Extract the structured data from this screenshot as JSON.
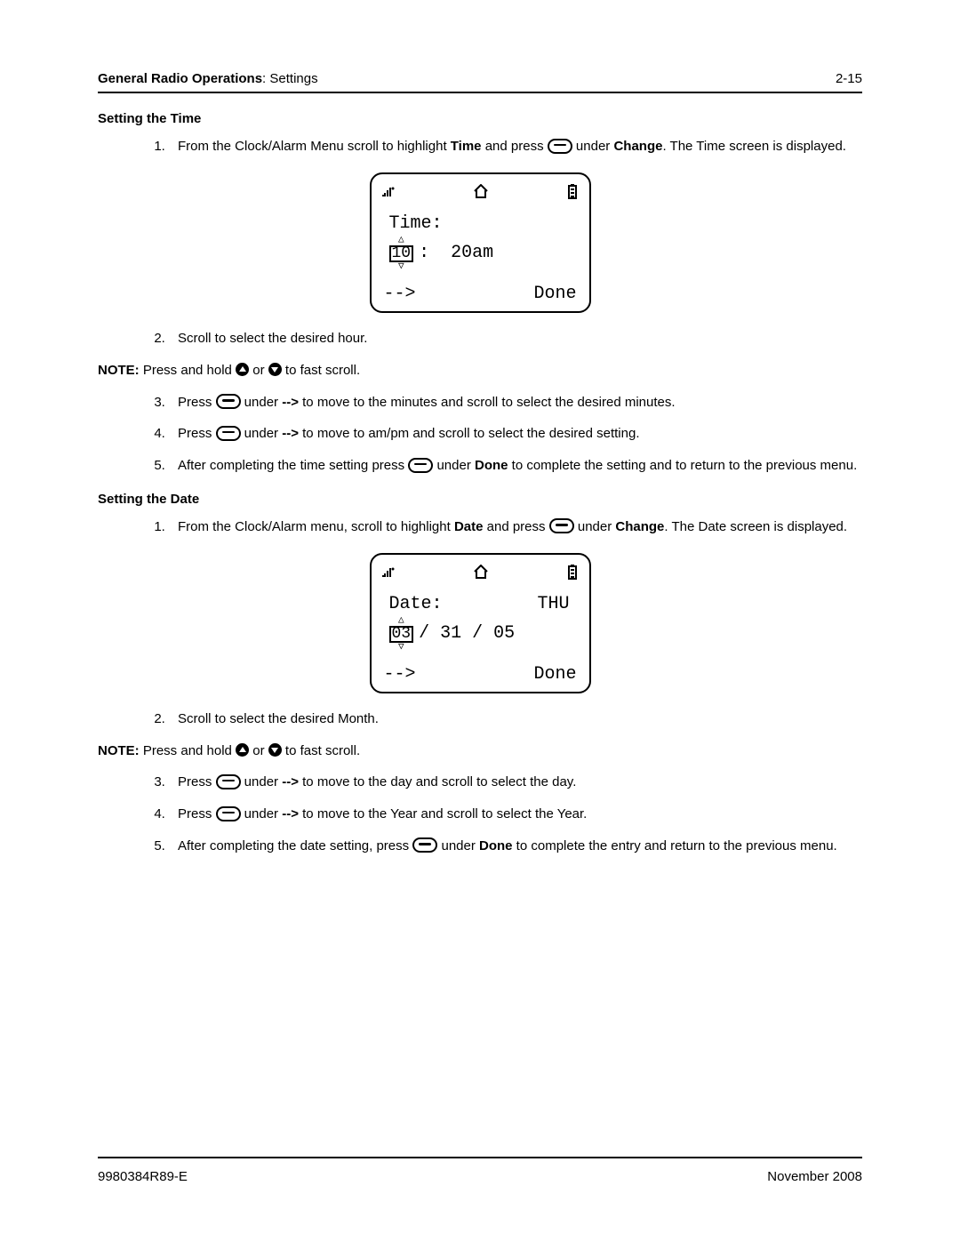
{
  "header": {
    "left_bold": "General Radio Operations",
    "left_rest": ": Settings",
    "right": "2-15"
  },
  "sections": {
    "time": {
      "heading": "Setting the Time",
      "step1a": "From the Clock/Alarm Menu scroll to highlight ",
      "step1b": "Time",
      "step1c": " and press ",
      "step1d": " under ",
      "step1e": "Change",
      "step1f": ". The Time screen is displayed.",
      "screen": {
        "label": "Time:",
        "sel": "10",
        "rest1": ":",
        "rest2": "20am",
        "left_soft": "-->",
        "right_soft": "Done"
      },
      "step2": "Scroll to select the desired hour.",
      "note_a": "NOTE:",
      "note_b": " Press and hold ",
      "note_c": " or ",
      "note_d": " to fast scroll.",
      "step3a": "Press ",
      "step3b": " under ",
      "step3c": "-->",
      "step3d": " to move to the minutes and scroll to select the desired minutes.",
      "step4a": "Press ",
      "step4b": " under ",
      "step4c": "-->",
      "step4d": " to move to am/pm and scroll to select the desired setting.",
      "step5a": "After completing the time setting press ",
      "step5b": " under ",
      "step5c": "Done",
      "step5d": " to complete the setting and to return to the previous menu."
    },
    "date": {
      "heading": "Setting the Date",
      "step1a": "From the Clock/Alarm menu, scroll to highlight ",
      "step1b": "Date",
      "step1c": " and press ",
      "step1d": " under ",
      "step1e": "Change",
      "step1f": ". The Date screen is displayed.",
      "screen": {
        "label": "Date:",
        "day": "THU",
        "sel": "03",
        "rest": " / 31 / 05",
        "left_soft": "-->",
        "right_soft": "Done"
      },
      "step2": "Scroll to select the desired Month.",
      "note_a": "NOTE:",
      "note_b": " Press and hold ",
      "note_c": " or ",
      "note_d": " to fast scroll.",
      "step3a": "Press ",
      "step3b": " under ",
      "step3c": "-->",
      "step3d": " to move to the day and scroll to select the day.",
      "step4a": "Press ",
      "step4b": " under ",
      "step4c": "-->",
      "step4d": " to move to the Year and scroll to select the Year.",
      "step5a": "After completing the date setting, press ",
      "step5b": " under ",
      "step5c": "Done",
      "step5d": " to complete the entry and return to the previous menu."
    }
  },
  "footer": {
    "left": "9980384R89-E",
    "right": "November 2008"
  }
}
